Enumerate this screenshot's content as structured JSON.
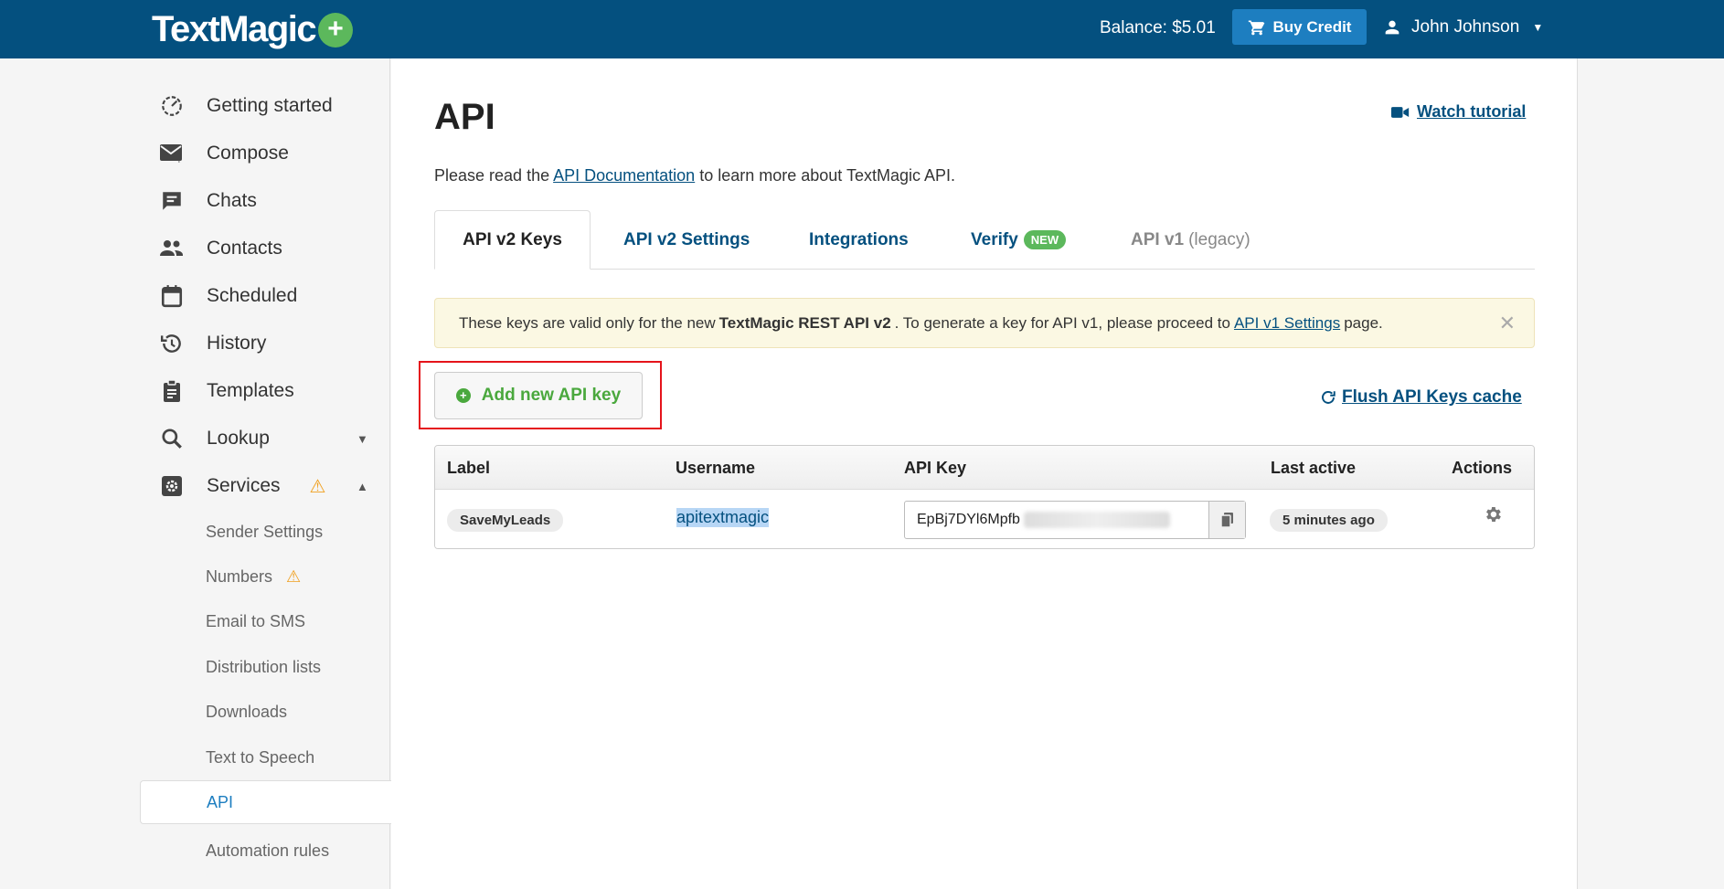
{
  "header": {
    "logo": "TextMagic",
    "balance": "Balance: $5.01",
    "buy_credit": "Buy Credit",
    "user_name": "John Johnson"
  },
  "sidebar": {
    "items": [
      {
        "label": "Getting started",
        "icon": "gauge-icon"
      },
      {
        "label": "Compose",
        "icon": "envelope-icon"
      },
      {
        "label": "Chats",
        "icon": "chat-icon"
      },
      {
        "label": "Contacts",
        "icon": "people-icon"
      },
      {
        "label": "Scheduled",
        "icon": "calendar-icon"
      },
      {
        "label": "History",
        "icon": "history-icon"
      },
      {
        "label": "Templates",
        "icon": "clipboard-icon"
      },
      {
        "label": "Lookup",
        "icon": "search-icon"
      },
      {
        "label": "Services",
        "icon": "gear-box-icon"
      }
    ],
    "sub_items": [
      "Sender Settings",
      "Numbers",
      "Email to SMS",
      "Distribution lists",
      "Downloads",
      "Text to Speech",
      "API",
      "Automation rules"
    ],
    "active_sub": "API"
  },
  "main": {
    "title": "API",
    "watch_tutorial": "Watch tutorial",
    "intro_before": "Please read the",
    "intro_link": "API Documentation",
    "intro_after": "to learn more about TextMagic API.",
    "tabs": [
      {
        "label": "API v2 Keys"
      },
      {
        "label": "API v2 Settings"
      },
      {
        "label": "Integrations"
      },
      {
        "label": "Verify",
        "badge": "NEW"
      },
      {
        "label": "API v1",
        "suffix": "(legacy)"
      }
    ],
    "notice": {
      "part1": "These keys are valid only for the new",
      "bold": "TextMagic REST API v2",
      "part2": ". To generate a key for API v1, please proceed to",
      "link": "API v1 Settings",
      "part3": "page."
    },
    "add_button": "Add new API key",
    "flush_button": "Flush API Keys cache",
    "table": {
      "headers": [
        "Label",
        "Username",
        "API Key",
        "Last active",
        "Actions"
      ],
      "rows": [
        {
          "label": "SaveMyLeads",
          "username": "apitextmagic",
          "api_key": "EpBj7DYl6Mpfb",
          "last_active": "5 minutes ago"
        }
      ]
    }
  },
  "colors": {
    "topbar": "#04507f",
    "accent": "#1d7ec0",
    "green": "#5cb85c",
    "highlight": "#e5141b"
  }
}
